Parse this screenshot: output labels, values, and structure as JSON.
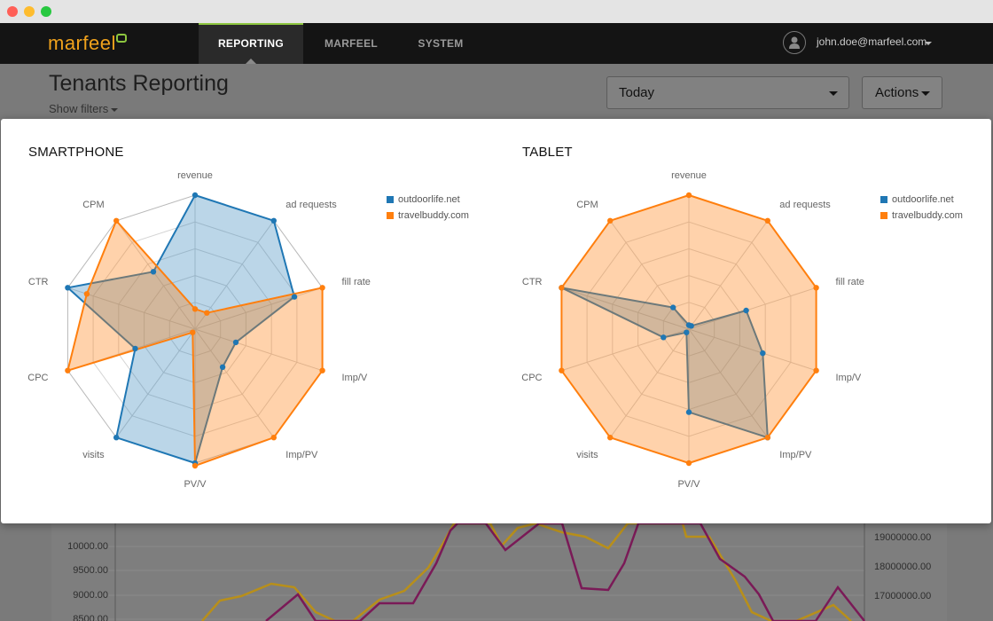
{
  "navbar": {
    "logo_text": "marfeel",
    "tabs": [
      {
        "label": "REPORTING",
        "active": true
      },
      {
        "label": "MARFEEL",
        "active": false
      },
      {
        "label": "SYSTEM",
        "active": false
      }
    ],
    "user_email": "john.doe@marfeel.com"
  },
  "page": {
    "title": "Tenants Reporting",
    "show_filters": "Show filters"
  },
  "toolbar": {
    "date_range": "Today",
    "actions_label": "Actions"
  },
  "colors": {
    "outdoorlife": "#1f77b4",
    "travelbuddy": "#ff7f0e",
    "brand_green": "#8dc63f",
    "brand_orange": "#f0a21c"
  },
  "background_chart": {
    "left_axis": [
      "10000.00",
      "9500.00",
      "9000.00",
      "8500.00"
    ],
    "right_axis": [
      "19000000.00",
      "18000000.00",
      "17000000.00"
    ]
  },
  "modal": {
    "charts": [
      {
        "id": "smartphone",
        "title": "SMARTPHONE"
      },
      {
        "id": "tablet",
        "title": "TABLET"
      }
    ]
  },
  "chart_data": [
    {
      "type": "radar",
      "title": "SMARTPHONE",
      "axes": [
        "revenue",
        "ad requests",
        "fill rate",
        "Imp/V",
        "Imp/PV",
        "PV/V",
        "visits",
        "CPC",
        "CTR",
        "CPM"
      ],
      "scale_max": 100,
      "series": [
        {
          "name": "outdoorlife.net",
          "values": [
            100,
            100,
            78,
            32,
            35,
            100,
            100,
            47,
            100,
            53
          ]
        },
        {
          "name": "travelbuddy.com",
          "values": [
            15,
            15,
            100,
            100,
            100,
            102,
            3,
            100,
            85,
            100
          ]
        }
      ]
    },
    {
      "type": "radar",
      "title": "TABLET",
      "axes": [
        "revenue",
        "ad requests",
        "fill rate",
        "Imp/V",
        "Imp/PV",
        "PV/V",
        "visits",
        "CPC",
        "CTR",
        "CPM"
      ],
      "scale_max": 100,
      "series": [
        {
          "name": "outdoorlife.net",
          "values": [
            3,
            3,
            45,
            58,
            100,
            62,
            3,
            20,
            100,
            20
          ]
        },
        {
          "name": "travelbuddy.com",
          "values": [
            100,
            100,
            100,
            100,
            100,
            100,
            100,
            100,
            100,
            100
          ]
        }
      ]
    }
  ]
}
